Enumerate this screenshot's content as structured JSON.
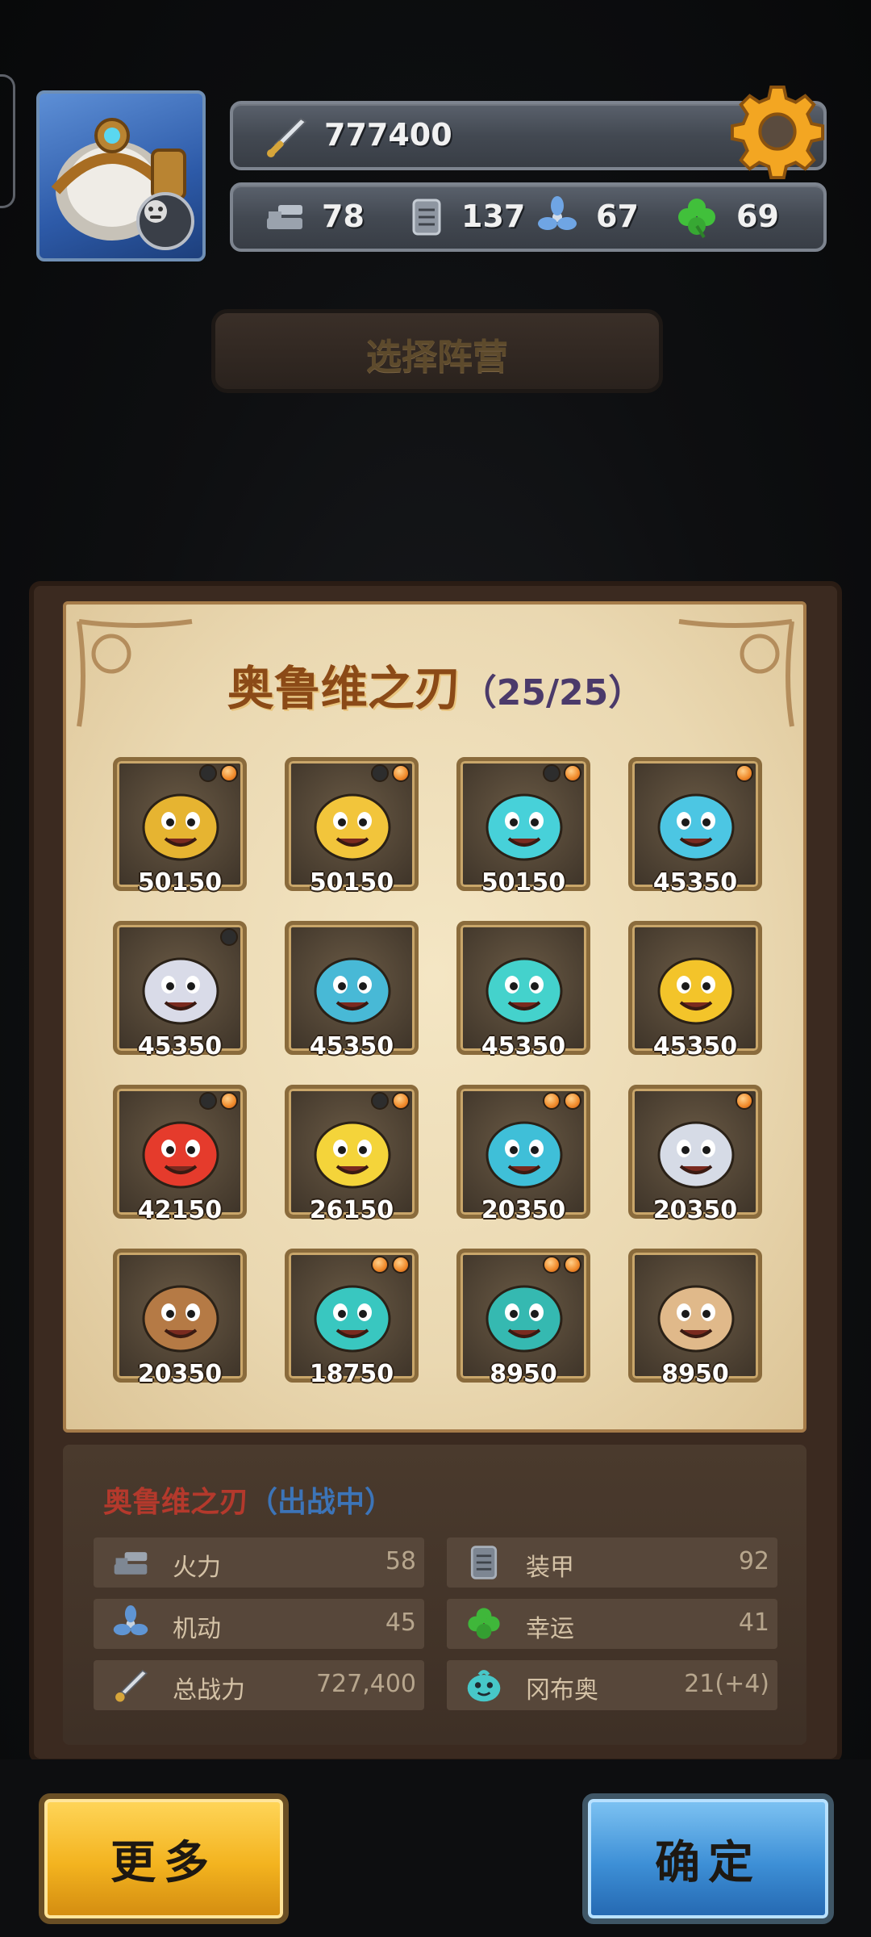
{
  "header": {
    "power": "777400",
    "stats": [
      {
        "icon": "cannon-icon",
        "value": "78"
      },
      {
        "icon": "armor-plate-icon",
        "value": "137"
      },
      {
        "icon": "propeller-icon",
        "value": "67"
      },
      {
        "icon": "clover-icon",
        "value": "69"
      }
    ]
  },
  "select_faction_label": "选择阵营",
  "faction": {
    "name": "奥鲁维之刃",
    "count": "（25/25）"
  },
  "heroes": [
    {
      "score": "50150",
      "dots": [
        "black",
        "orange"
      ],
      "color": "#e6b431"
    },
    {
      "score": "50150",
      "dots": [
        "black",
        "orange"
      ],
      "color": "#f2c53b"
    },
    {
      "score": "50150",
      "dots": [
        "black",
        "orange"
      ],
      "color": "#47d1d9"
    },
    {
      "score": "45350",
      "dots": [
        "orange"
      ],
      "color": "#4cc6e3"
    },
    {
      "score": "45350",
      "dots": [
        "black"
      ],
      "color": "#d9dbe8"
    },
    {
      "score": "45350",
      "dots": [],
      "color": "#48b9d6"
    },
    {
      "score": "45350",
      "dots": [],
      "color": "#44d2cc"
    },
    {
      "score": "45350",
      "dots": [],
      "color": "#f3c42a"
    },
    {
      "score": "42150",
      "dots": [
        "black",
        "orange"
      ],
      "color": "#e53b2c"
    },
    {
      "score": "26150",
      "dots": [
        "black",
        "orange"
      ],
      "color": "#f4d43a"
    },
    {
      "score": "20350",
      "dots": [
        "orange",
        "orange"
      ],
      "color": "#3fbfd8"
    },
    {
      "score": "20350",
      "dots": [
        "orange"
      ],
      "color": "#d6dbe6"
    },
    {
      "score": "20350",
      "dots": [],
      "color": "#b57a45"
    },
    {
      "score": "18750",
      "dots": [
        "orange",
        "orange"
      ],
      "color": "#39c7c0"
    },
    {
      "score": "8950",
      "dots": [
        "orange",
        "orange"
      ],
      "color": "#35b9b1"
    },
    {
      "score": "8950",
      "dots": [],
      "color": "#e0b98a"
    }
  ],
  "info": {
    "name": "奥鲁维之刃",
    "status": "（出战中）",
    "rows": [
      {
        "label": "火力",
        "value": "58",
        "icon": "cannon-icon"
      },
      {
        "label": "装甲",
        "value": "92",
        "icon": "armor-plate-icon"
      },
      {
        "label": "机动",
        "value": "45",
        "icon": "propeller-icon"
      },
      {
        "label": "幸运",
        "value": "41",
        "icon": "clover-icon"
      },
      {
        "label": "总战力",
        "value": "727,400",
        "icon": "sword-icon"
      },
      {
        "label": "冈布奥",
        "value": "21(+4)",
        "icon": "gumball-icon"
      }
    ]
  },
  "buttons": {
    "more": "更多",
    "confirm": "确定"
  }
}
